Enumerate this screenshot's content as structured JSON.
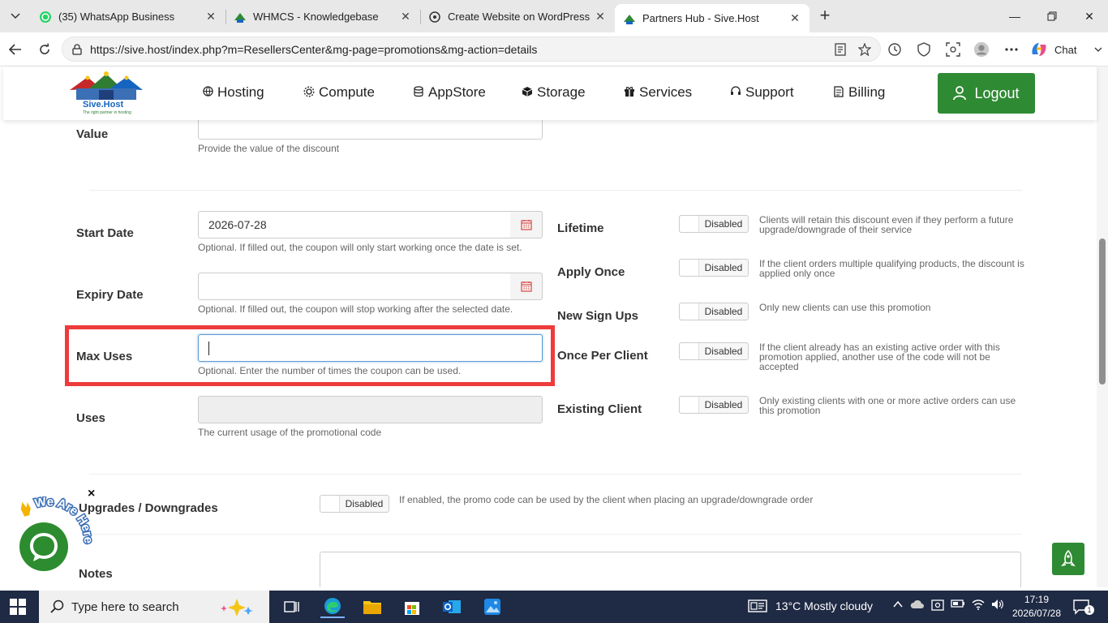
{
  "browser": {
    "tabs": [
      {
        "label": "(35) WhatsApp Business",
        "icon": "whatsapp-icon"
      },
      {
        "label": "WHMCS - Knowledgebase",
        "icon": "sive-host-icon"
      },
      {
        "label": "Create Website on WordPress",
        "icon": "openai-icon"
      },
      {
        "label": "Partners Hub - Sive.Host",
        "icon": "sive-host-icon",
        "active": true
      }
    ],
    "url": "https://sive.host/index.php?m=ResellersCenter&mg-page=promotions&mg-action=details",
    "chat_label": "Chat"
  },
  "site": {
    "logo_text": "Sive.Host",
    "logo_tagline": "The right partner in hosting",
    "nav": [
      {
        "label": "Hosting",
        "icon": "globe-icon"
      },
      {
        "label": "Compute",
        "icon": "gear-icon"
      },
      {
        "label": "AppStore",
        "icon": "database-icon"
      },
      {
        "label": "Storage",
        "icon": "box-icon"
      },
      {
        "label": "Services",
        "icon": "gift-icon"
      },
      {
        "label": "Support",
        "icon": "headset-icon"
      },
      {
        "label": "Billing",
        "icon": "invoice-icon"
      }
    ],
    "logout_label": "Logout",
    "brand_color": "#2f8a34"
  },
  "form": {
    "value": {
      "label": "Value",
      "help": "Provide the value of the discount"
    },
    "start_date": {
      "label": "Start Date",
      "value": "2026-07-28",
      "help": "Optional. If filled out, the coupon will only start working once the date is set."
    },
    "expiry_date": {
      "label": "Expiry Date",
      "value": "",
      "help": "Optional. If filled out, the coupon will stop working after the selected date."
    },
    "max_uses": {
      "label": "Max Uses",
      "value": "",
      "help": "Optional. Enter the number of times the coupon can be used."
    },
    "uses": {
      "label": "Uses",
      "help": "The current usage of the promotional code"
    },
    "toggles": [
      {
        "label": "Lifetime",
        "state": "Disabled",
        "desc": "Clients will retain this discount even if they perform a future upgrade/downgrade of their service"
      },
      {
        "label": "Apply Once",
        "state": "Disabled",
        "desc": "If the client orders multiple qualifying products, the discount is applied only once"
      },
      {
        "label": "New Sign Ups",
        "state": "Disabled",
        "desc": "Only new clients can use this promotion"
      },
      {
        "label": "Once Per Client",
        "state": "Disabled",
        "desc": "If the client already has an existing active order with this promotion applied, another use of the code will not be accepted"
      },
      {
        "label": "Existing Client",
        "state": "Disabled",
        "desc": "Only existing clients with one or more active orders can use this promotion"
      }
    ],
    "upgrades": {
      "label": "Upgrades / Downgrades",
      "state": "Disabled",
      "desc": "If enabled, the promo code can be used by the client when placing an upgrade/downgrade order"
    },
    "notes": {
      "label": "Notes"
    },
    "highlight_color": "#ee3b3b"
  },
  "chat_widget": {
    "tagline": "We Are Here!",
    "close": "×"
  },
  "taskbar": {
    "search_placeholder": "Type here to search",
    "weather": "13°C  Mostly cloudy",
    "time": "17:19",
    "date": "2026/07/28",
    "notif_count": "1"
  }
}
